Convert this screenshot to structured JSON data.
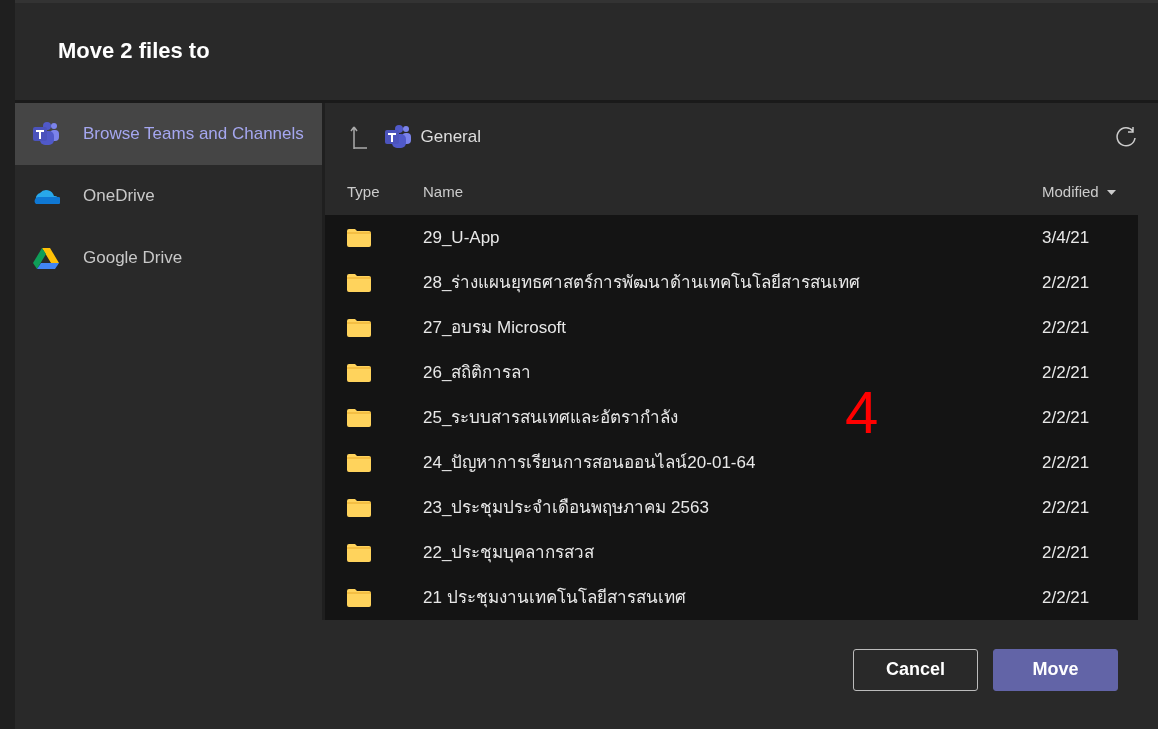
{
  "dialog": {
    "title": "Move 2 files to"
  },
  "sidebar": {
    "items": [
      {
        "label": "Browse Teams and Channels",
        "kind": "teams",
        "selected": true
      },
      {
        "label": "OneDrive",
        "kind": "onedrive",
        "selected": false
      },
      {
        "label": "Google Drive",
        "kind": "gdrive",
        "selected": false
      }
    ]
  },
  "location": {
    "label": "General"
  },
  "table": {
    "columns": [
      "Type",
      "Name",
      "Modified"
    ],
    "rows": [
      {
        "name": "29_U-App",
        "modified": "3/4/21"
      },
      {
        "name": "28_ร่างแผนยุทธศาสตร์การพัฒนาด้านเทคโนโลยีสารสนเทศ",
        "modified": "2/2/21"
      },
      {
        "name": "27_อบรม Microsoft",
        "modified": "2/2/21"
      },
      {
        "name": "26_สถิติการลา",
        "modified": "2/2/21"
      },
      {
        "name": "25_ระบบสารสนเทศและอัตรากำลัง",
        "modified": "2/2/21"
      },
      {
        "name": "24_ปัญหาการเรียนการสอนออนไลน์20-01-64",
        "modified": "2/2/21"
      },
      {
        "name": "23_ประชุมประจำเดือนพฤษภาคม 2563",
        "modified": "2/2/21"
      },
      {
        "name": "22_ประชุมบุคลากรสวส",
        "modified": "2/2/21"
      },
      {
        "name": "21 ประชุมงานเทคโนโลยีสารสนเทศ",
        "modified": "2/2/21"
      }
    ]
  },
  "buttons": [
    {
      "label": "Cancel",
      "kind": "secondary"
    },
    {
      "label": "Move",
      "kind": "primary"
    }
  ],
  "annotation": "4"
}
